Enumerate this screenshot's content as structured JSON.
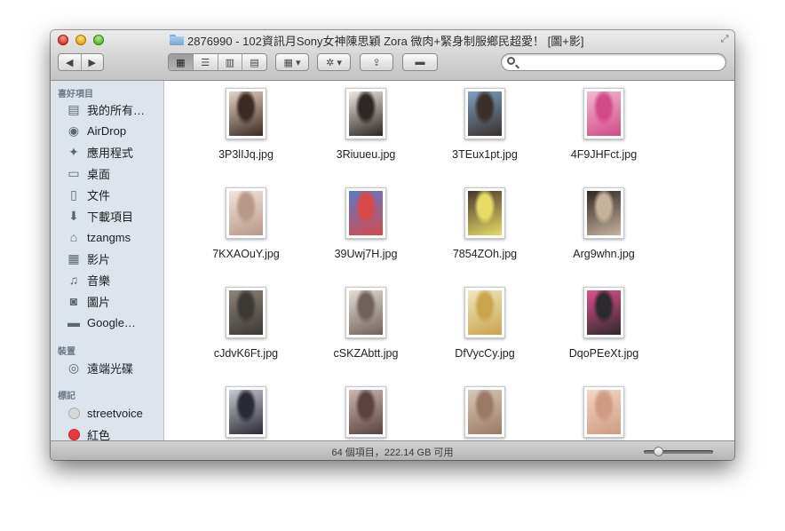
{
  "window": {
    "title": "2876990 - 102資訊月Sony女神陳思穎 Zora  微肉+緊身制服鄉民超愛！ [圖+影]"
  },
  "toolbar": {
    "back_glyph": "◀",
    "forward_glyph": "▶",
    "view_icons_glyph": "▦",
    "view_list_glyph": "☰",
    "view_columns_glyph": "▥",
    "view_coverflow_glyph": "▤",
    "arrange_glyph": "▦ ▾",
    "action_glyph": "✲ ▾",
    "share_glyph": "⇪",
    "tags_glyph": "▬",
    "search_placeholder": ""
  },
  "sidebar": {
    "favorites_header": "喜好項目",
    "favorites": [
      {
        "label": "我的所有…",
        "icon": "all-files-icon"
      },
      {
        "label": "AirDrop",
        "icon": "airdrop-icon"
      },
      {
        "label": "應用程式",
        "icon": "applications-icon"
      },
      {
        "label": "桌面",
        "icon": "desktop-icon"
      },
      {
        "label": "文件",
        "icon": "documents-icon"
      },
      {
        "label": "下載項目",
        "icon": "downloads-icon"
      },
      {
        "label": "tzangms",
        "icon": "home-icon"
      },
      {
        "label": "影片",
        "icon": "movies-icon"
      },
      {
        "label": "音樂",
        "icon": "music-icon"
      },
      {
        "label": "圖片",
        "icon": "pictures-icon"
      },
      {
        "label": "Google…",
        "icon": "folder-icon"
      }
    ],
    "devices_header": "裝置",
    "devices": [
      {
        "label": "遠端光碟",
        "icon": "remote-disc-icon"
      }
    ],
    "tags_header": "標記",
    "tags": [
      {
        "label": "streetvoice",
        "color": "#d8d8d8"
      },
      {
        "label": "紅色",
        "color": "#e9393f"
      }
    ]
  },
  "files": [
    {
      "name": "3P3lIJq.jpg",
      "colors": [
        "#e7d3c4",
        "#3c2a22"
      ]
    },
    {
      "name": "3Riuueu.jpg",
      "colors": [
        "#efe8e2",
        "#2c2624"
      ]
    },
    {
      "name": "3TEux1pt.jpg",
      "colors": [
        "#7da0c4",
        "#3a2f2a"
      ]
    },
    {
      "name": "4F9JHFct.jpg",
      "colors": [
        "#f1b9cf",
        "#d14a86"
      ]
    },
    {
      "name": "7KXAOuY.jpg",
      "colors": [
        "#f2e4dc",
        "#b89887"
      ]
    },
    {
      "name": "39Uwj7H.jpg",
      "colors": [
        "#5a79c8",
        "#d64a4a"
      ]
    },
    {
      "name": "7854ZOh.jpg",
      "colors": [
        "#49352b",
        "#e6dc66"
      ]
    },
    {
      "name": "Arg9whn.jpg",
      "colors": [
        "#2e2824",
        "#c7b39c"
      ]
    },
    {
      "name": "cJdvK6Ft.jpg",
      "colors": [
        "#8c8378",
        "#3c3834"
      ]
    },
    {
      "name": "cSKZAbtt.jpg",
      "colors": [
        "#e3ddd6",
        "#6f625a"
      ]
    },
    {
      "name": "DfVycCy.jpg",
      "colors": [
        "#f0e8bc",
        "#caa44c"
      ]
    },
    {
      "name": "DqoPEeXt.jpg",
      "colors": [
        "#e34f8d",
        "#2c2a2c"
      ]
    },
    {
      "name": "",
      "colors": [
        "#c6c9d2",
        "#2a2a35"
      ]
    },
    {
      "name": "",
      "colors": [
        "#cdb7b0",
        "#5b423c"
      ]
    },
    {
      "name": "",
      "colors": [
        "#d9c7b6",
        "#9a7a66"
      ]
    },
    {
      "name": "",
      "colors": [
        "#f2d6c8",
        "#d09b82"
      ]
    }
  ],
  "status": {
    "text": "64 個項目，222.14 GB 可用",
    "icon_size_slider_position": 0.2
  }
}
